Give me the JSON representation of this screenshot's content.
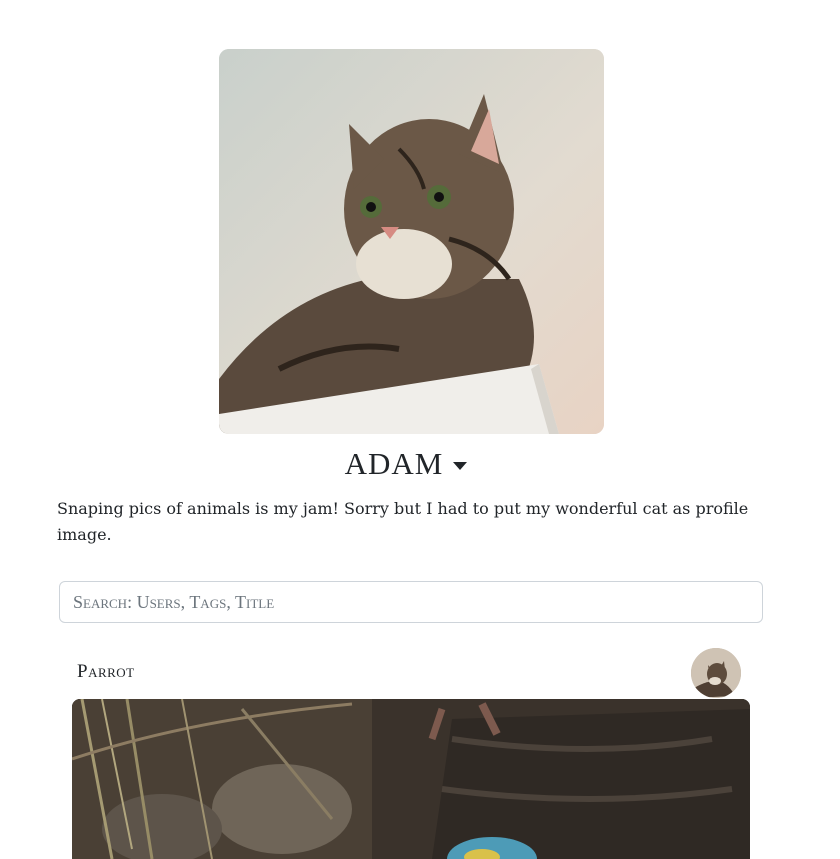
{
  "profile": {
    "username": "ADAM",
    "bio": "Snaping pics of animals is my jam! Sorry but I had to put my wonderful cat as profile image."
  },
  "search": {
    "placeholder": "Search: Users, Tags, Title"
  },
  "posts": [
    {
      "title": "Parrot"
    }
  ]
}
